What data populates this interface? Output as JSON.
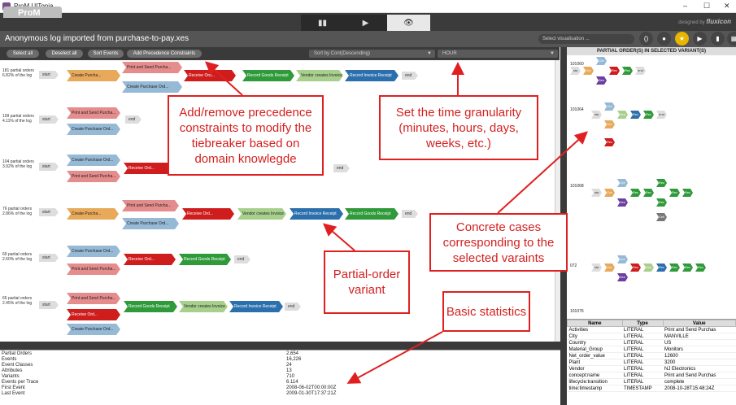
{
  "window": {
    "title": "ProM UITopia",
    "minimize": "–",
    "maximize": "☐",
    "close": "✕"
  },
  "brand": {
    "name": "ProM",
    "by": "designed by",
    "company": "fluxicon"
  },
  "tabs": [
    {
      "icon": "▮▮"
    },
    {
      "icon": "▶"
    },
    {
      "icon": "👁"
    }
  ],
  "header": {
    "title": "Anonymous log imported from purchase-to-pay.xes",
    "visualisation_placeholder": "Select visualisation ..."
  },
  "toolbar": {
    "select_all": "Select all",
    "deselect_all": "Deselect all",
    "sort_events": "Sort Events",
    "add_constraints": "Add Precedence Constraints",
    "sort_by": "Sort by Cont(Descending)",
    "granularity": "HOUR"
  },
  "variants": [
    {
      "info": "181 partial orders 6.82% of the log"
    },
    {
      "info": "109 partial orders 4.11% of the log"
    },
    {
      "info": "104 partial orders 3.92% of the log"
    },
    {
      "info": "76 partial orders 2.86% of the log"
    },
    {
      "info": "69 partial orders 2.60% of the log"
    },
    {
      "info": "65 partial orders 2.45% of the log"
    }
  ],
  "labels": {
    "start": "start",
    "end": "end",
    "create": "Create Purcha...",
    "create_ord": "Create Purchase Ord...",
    "print": "Print and Send Purcha...",
    "print_full": "Print and Send Purcha...",
    "receive": "Receive Ord...",
    "goods": "Record Goods Receipt",
    "vendor": "Vendor creates Invoice",
    "invoice": "Record Invoice Receipt"
  },
  "statistics": [
    {
      "label": "Partial Orders",
      "value": "2,654"
    },
    {
      "label": "Events",
      "value": "16,226"
    },
    {
      "label": "Event Classes",
      "value": "24"
    },
    {
      "label": "Attributes",
      "value": "13"
    },
    {
      "label": "Variants",
      "value": "710"
    },
    {
      "label": "Events per Trace",
      "value": "6.114"
    },
    {
      "label": "First Event",
      "value": "2008-06-02T00:00:00Z"
    },
    {
      "label": "Last Event",
      "value": "2009-01-30T17:37:21Z"
    }
  ],
  "right_panel": {
    "heading": "PARTIAL ORDER(S) IN SELECTED VARIANT(S)",
    "cases": [
      "101060",
      "101064",
      "101068",
      "072",
      "101076"
    ],
    "mini": {
      "start": "sta",
      "end": "end",
      "cre": "Cre",
      "sen": "Sen",
      "rec": "Rec",
      "ven": "Ven",
      "cell": "Cell"
    }
  },
  "attributes": {
    "headers": [
      "Name",
      "Type",
      "Value"
    ],
    "rows": [
      [
        "Activities",
        "LITERAL",
        "Print and Send Purchas"
      ],
      [
        "City",
        "LITERAL",
        "MANVILLE"
      ],
      [
        "Country",
        "LITERAL",
        "US"
      ],
      [
        "Material_Group",
        "LITERAL",
        "Monitors"
      ],
      [
        "Net_order_value",
        "LITERAL",
        "12600"
      ],
      [
        "Plant",
        "LITERAL",
        "3200"
      ],
      [
        "Vendor",
        "LITERAL",
        "NJ Electronics"
      ],
      [
        "concept:name",
        "LITERAL",
        "Print and Send Purchas"
      ],
      [
        "lifecycle:transition",
        "LITERAL",
        "complete"
      ],
      [
        "time:timestamp",
        "TIMESTAMP",
        "2008-10-28T15:48:24Z"
      ]
    ]
  },
  "callouts": {
    "constraints": "Add/remove precedence constraints to modify the tiebreaker based on domain knowlegde",
    "granularity": "Set the time granularity (minutes, hours, days, weeks, etc.)",
    "cases": "Concrete cases corresponding to the selected varaints",
    "variant": "Partial-order variant",
    "stats": "Basic statistics"
  },
  "colors": {
    "create": "#e8a95a",
    "print": "#e58c8c",
    "create_ord": "#96b9d6",
    "receive": "#cf1d1d",
    "goods": "#2f9a3a",
    "vendor": "#a8d08d",
    "invoice": "#2c6fad",
    "purple": "#6b3fa0",
    "callout": "#e02020"
  }
}
